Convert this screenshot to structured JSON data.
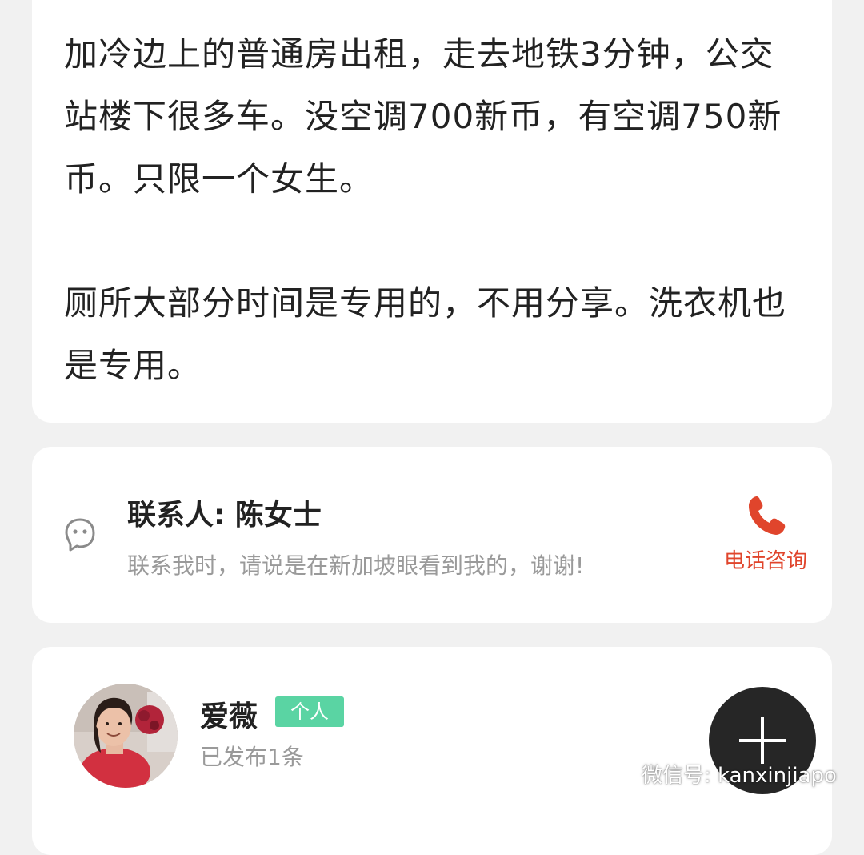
{
  "description": {
    "paragraph_1": "加冷边上的普通房出租，走去地铁3分钟，公交站楼下很多车。没空调700新币，有空调750新币。只限一个女生。",
    "paragraph_2": "厕所大部分时间是专用的，不用分享。洗衣机也是专用。"
  },
  "contact": {
    "name": "联系人: 陈女士",
    "tip": "联系我时，请说是在新加坡眼看到我的，谢谢!",
    "call_label": "电话咨询",
    "icon": "chat-bubble-icon"
  },
  "user": {
    "name": "爱薇",
    "tag": "个人",
    "posts": "已发布1条"
  },
  "watermark": {
    "text": "微信号: kanxinjiapo"
  },
  "colors": {
    "accent_red": "#e0452c",
    "tag_green": "#5ad4a3",
    "fab_dark": "#262626"
  }
}
